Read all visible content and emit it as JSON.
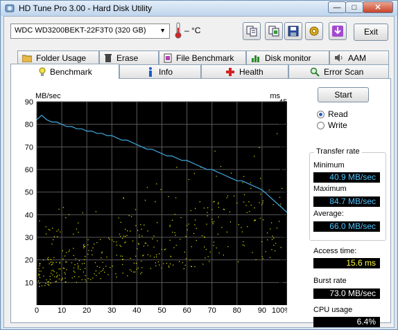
{
  "window": {
    "title": "HD Tune Pro 3.00 - Hard Disk Utility",
    "controls": {
      "minimize": "—",
      "maximize": "□",
      "close": "✕"
    }
  },
  "toolbar": {
    "drive": "WDC WD3200BEKT-22F3T0 (320 GB)",
    "temperature": "– °C",
    "exit_label": "Exit",
    "icons": [
      "copy-text-icon",
      "copy-screenshot-icon",
      "save-icon",
      "options-icon",
      "download-icon"
    ]
  },
  "tabs_top": [
    {
      "label": "Folder Usage",
      "icon": "folder-icon"
    },
    {
      "label": "Erase",
      "icon": "trash-icon"
    },
    {
      "label": "File Benchmark",
      "icon": "file-benchmark-icon"
    },
    {
      "label": "Disk monitor",
      "icon": "disk-monitor-icon"
    },
    {
      "label": "AAM",
      "icon": "speaker-icon"
    }
  ],
  "tabs_bottom": [
    {
      "label": "Benchmark",
      "icon": "bulb-icon",
      "active": true
    },
    {
      "label": "Info",
      "icon": "info-icon"
    },
    {
      "label": "Health",
      "icon": "health-cross-icon"
    },
    {
      "label": "Error Scan",
      "icon": "magnifier-icon"
    }
  ],
  "benchmark": {
    "start_label": "Start",
    "mode": {
      "read_label": "Read",
      "write_label": "Write",
      "selected": "Read"
    },
    "transfer_rate_title": "Transfer rate",
    "minimum_label": "Minimum",
    "minimum_value": "40.9 MB/sec",
    "maximum_label": "Maximum",
    "maximum_value": "84.7 MB/sec",
    "average_label": "Average:",
    "average_value": "66.0 MB/sec",
    "access_time_label": "Access time:",
    "access_time_value": "15.6 ms",
    "burst_rate_label": "Burst rate",
    "burst_rate_value": "73.0 MB/sec",
    "cpu_usage_label": "CPU usage",
    "cpu_usage_value": "6.4%"
  },
  "colors": {
    "plot_bg": "#000000",
    "grid": "#595959",
    "transfer_line": "#3fa9e0",
    "access_dots": "#f0f000",
    "value_blue": "#4fc3ff",
    "value_yellow": "#ffff40"
  },
  "chart_data": {
    "type": "line",
    "ylabel_left": "MB/sec",
    "ylabel_right": "ms",
    "left_ticks": [
      "90",
      "80",
      "70",
      "60",
      "50",
      "40",
      "30",
      "20",
      "10"
    ],
    "right_ticks": [
      "45",
      "40",
      "35",
      "30",
      "25",
      "20",
      "15",
      "10",
      "5"
    ],
    "x_ticks": [
      "0",
      "10",
      "20",
      "30",
      "40",
      "50",
      "60",
      "70",
      "80",
      "90",
      "100%"
    ],
    "xlim": [
      0,
      100
    ],
    "ylim_left": [
      0,
      90
    ],
    "ylim_right": [
      0,
      45
    ],
    "grid": true,
    "series": [
      {
        "name": "transfer rate",
        "axis": "left",
        "x": [
          0,
          2,
          4,
          6,
          8,
          10,
          12,
          14,
          16,
          18,
          20,
          22,
          24,
          26,
          28,
          30,
          32,
          34,
          36,
          38,
          40,
          42,
          44,
          46,
          48,
          50,
          52,
          54,
          56,
          58,
          60,
          62,
          64,
          66,
          68,
          70,
          72,
          74,
          76,
          78,
          80,
          82,
          84,
          86,
          88,
          90,
          92,
          94,
          96,
          98,
          100
        ],
        "values": [
          82,
          84,
          82,
          81,
          81,
          80,
          79,
          79,
          78,
          78,
          77,
          77,
          76,
          76,
          75,
          75,
          74,
          73,
          73,
          72,
          71,
          70,
          69,
          69,
          68,
          67,
          66,
          66,
          65,
          64,
          64,
          63,
          62,
          61,
          60,
          60,
          59,
          58,
          57,
          56,
          55,
          55,
          54,
          53,
          52,
          51,
          49,
          47,
          45,
          43,
          41
        ]
      },
      {
        "name": "access time",
        "axis": "right",
        "type": "scatter",
        "description_range_ms": [
          3,
          38
        ]
      }
    ]
  }
}
